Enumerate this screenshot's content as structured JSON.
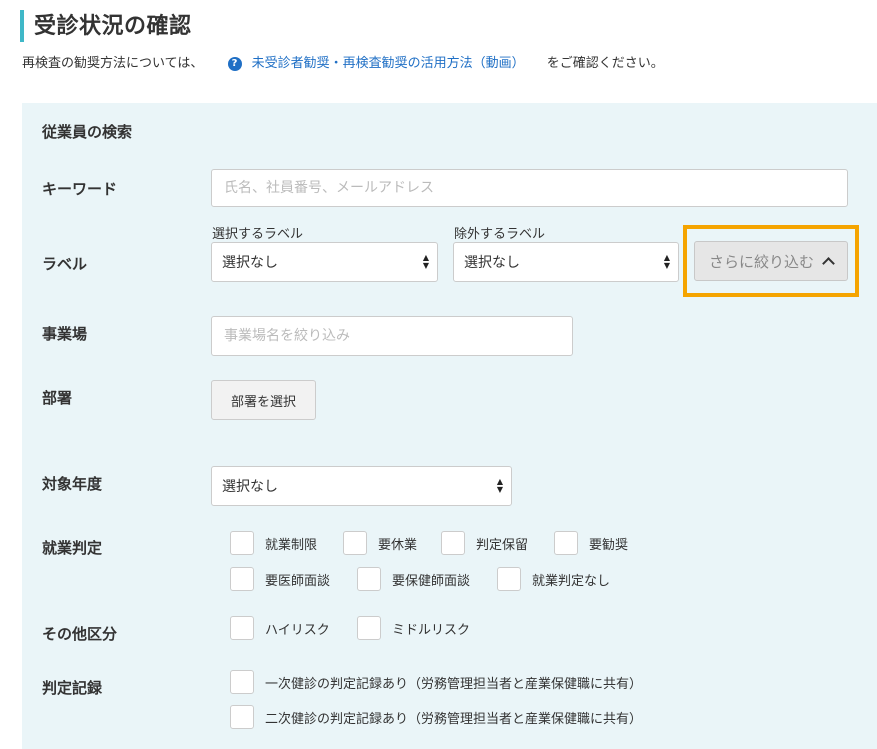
{
  "header": {
    "title": "受診状況の確認",
    "lead_before": "再検査の勧奨方法については、",
    "help_icon_glyph": "?",
    "lead_link": "未受診者勧奨・再検査勧奨の活用方法（動画）",
    "lead_after": "をご確認ください。"
  },
  "search": {
    "heading": "従業員の検索",
    "keyword": {
      "label": "キーワード",
      "placeholder": "氏名、社員番号、メールアドレス",
      "value": ""
    },
    "label_row": {
      "label": "ラベル",
      "include_caption": "選択するラベル",
      "include_value": "選択なし",
      "exclude_caption": "除外するラベル",
      "exclude_value": "選択なし",
      "narrow_button": "さらに絞り込む"
    },
    "office": {
      "label": "事業場",
      "placeholder": "事業場名を絞り込み",
      "value": ""
    },
    "department": {
      "label": "部署",
      "button": "部署を選択"
    },
    "fiscal_year": {
      "label": "対象年度",
      "value": "選択なし"
    },
    "work_judgment": {
      "label": "就業判定",
      "options": [
        "就業制限",
        "要休業",
        "判定保留",
        "要勧奨",
        "要医師面談",
        "要保健師面談",
        "就業判定なし"
      ]
    },
    "other": {
      "label": "その他区分",
      "options": [
        "ハイリスク",
        "ミドルリスク"
      ]
    },
    "judgment_record": {
      "label": "判定記録",
      "options": [
        "一次健診の判定記録あり（労務管理担当者と産業保健職に共有）",
        "二次健診の判定記録あり（労務管理担当者と産業保健職に共有）"
      ]
    }
  },
  "colors": {
    "accent_bar": "#3fb8c8",
    "link": "#1f6fc5",
    "panel_bg": "#eaf5f8",
    "highlight": "#f5a400"
  }
}
